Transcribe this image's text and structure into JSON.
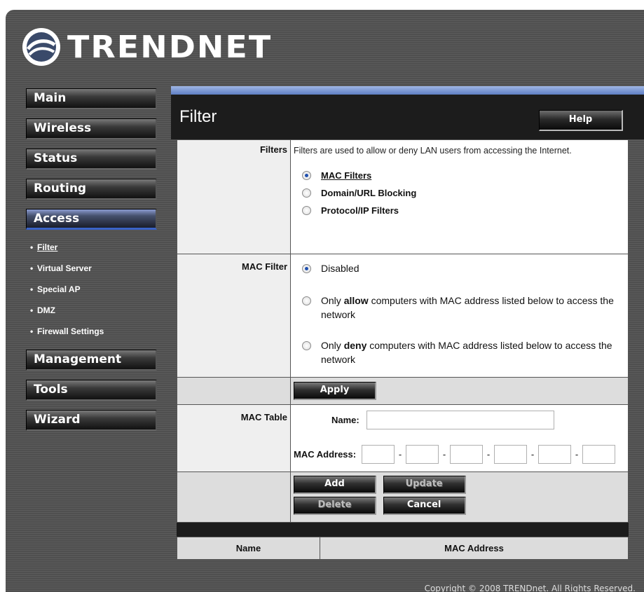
{
  "brand": {
    "name": "TRENDNET",
    "logo_icon": "trendnet-swoosh-icon"
  },
  "sidebar": {
    "items": [
      {
        "label": "Main"
      },
      {
        "label": "Wireless"
      },
      {
        "label": "Status"
      },
      {
        "label": "Routing"
      },
      {
        "label": "Access",
        "active": true
      },
      {
        "label": "Management"
      },
      {
        "label": "Tools"
      },
      {
        "label": "Wizard"
      }
    ],
    "access_subitems": [
      {
        "label": "Filter",
        "current": true
      },
      {
        "label": "Virtual Server"
      },
      {
        "label": "Special AP"
      },
      {
        "label": "DMZ"
      },
      {
        "label": "Firewall Settings"
      }
    ],
    "bullet": "•"
  },
  "header": {
    "title": "Filter",
    "help_label": "Help"
  },
  "filters": {
    "label": "Filters",
    "description": "Filters are used to allow or deny LAN users from accessing the Internet.",
    "options": [
      {
        "label": "MAC Filters",
        "selected": true
      },
      {
        "label": "Domain/URL Blocking",
        "selected": false
      },
      {
        "label": "Protocol/IP Filters",
        "selected": false
      }
    ]
  },
  "mac_filter": {
    "label": "MAC Filter",
    "options": [
      {
        "pre": "Disabled",
        "bold": "",
        "post": "",
        "selected": true
      },
      {
        "pre": "Only ",
        "bold": "allow",
        "post": " computers with MAC address listed below to access the network",
        "selected": false
      },
      {
        "pre": "Only ",
        "bold": "deny",
        "post": " computers with MAC address listed below to access the network",
        "selected": false
      }
    ]
  },
  "apply_label": "Apply",
  "mac_table": {
    "label": "MAC Table",
    "name_label": "Name:",
    "name_value": "",
    "mac_label": "MAC Address:",
    "mac_parts": [
      "",
      "",
      "",
      "",
      "",
      ""
    ],
    "separator": "-"
  },
  "actions": {
    "add": "Add",
    "update": "Update",
    "delete": "Delete",
    "cancel": "Cancel"
  },
  "list": {
    "columns": [
      "Name",
      "MAC Address"
    ]
  },
  "footer": {
    "copyright": "Copyright © 2008 TRENDnet. All Rights Reserved."
  },
  "colors": {
    "accent_blue": "#3a63c8",
    "radio_dot": "#1f4fae",
    "title_bar": "#1c1c1c"
  }
}
